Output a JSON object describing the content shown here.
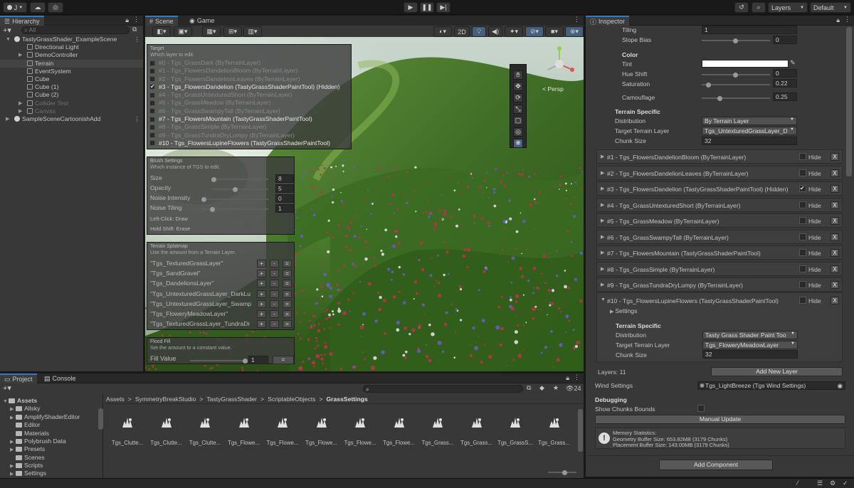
{
  "topbar": {
    "account": "J",
    "layers": "Layers",
    "layout": "Default"
  },
  "hierarchy": {
    "tab": "Hierarchy",
    "search_placeholder": "All",
    "items": [
      {
        "label": "TastyGrassShader_ExampleScene",
        "type": "scene"
      },
      {
        "label": "Directional Light",
        "type": "obj"
      },
      {
        "label": "DemoController",
        "type": "obj"
      },
      {
        "label": "Terrain",
        "type": "obj"
      },
      {
        "label": "EventSystem",
        "type": "obj"
      },
      {
        "label": "Cube",
        "type": "obj"
      },
      {
        "label": "Cube (1)",
        "type": "obj"
      },
      {
        "label": "Cube (2)",
        "type": "obj"
      },
      {
        "label": "Collider Test",
        "type": "obj"
      },
      {
        "label": "Canvas",
        "type": "obj"
      },
      {
        "label": "SampleSceneCartoonishAdd",
        "type": "scene"
      }
    ]
  },
  "scene": {
    "tab_scene": "Scene",
    "tab_game": "Game",
    "btn_2d": "2D",
    "persp": "< Persp"
  },
  "target_overlay": {
    "title": "Target",
    "subtitle": "Which layer to edit.",
    "layers": [
      "#0 - Tgs_GrassDark (ByTerrainLayer)",
      "#1 - Tgs_FlowersDandelionBloom (ByTerrainLayer)",
      "#2 - Tgs_FlowersDandelionLeaves (ByTerrainLayer)",
      "#3 - Tgs_FlowersDandelion (TastyGrassShaderPaintTool) (Hidden)",
      "#4 - Tgs_GrassUntexturedShort (ByTerrainLayer)",
      "#5 - Tgs_GrassMeadow (ByTerrainLayer)",
      "#6 - Tgs_GrassSwampyTall (ByTerrainLayer)",
      "#7 - Tgs_FlowersMountain (TastyGrassShaderPaintTool)",
      "#8 - Tgs_GrassSimple (ByTerrainLayer)",
      "#9 - Tgs_GrassTundraDryLumpy (ByTerrainLayer)",
      "#10 - Tgs_FlowersLupineFlowers (TastyGrassShaderPaintTool)"
    ]
  },
  "brush": {
    "title": "Brush Settings",
    "subtitle": "Which instance of TGS to edit.",
    "size_label": "Size",
    "size": "8",
    "opacity_label": "Opacity",
    "opacity": "5",
    "noise_intensity_label": "Noise Intensity",
    "noise_intensity": "0",
    "noise_tiling_label": "Noise Tiling",
    "noise_tiling": "1",
    "hint1": "Left-Click: Draw",
    "hint2": "Hold Shift: Erase"
  },
  "splatmap": {
    "title": "Terrain Splatmap",
    "subtitle": "Use the amount from a Terrain Layer.",
    "layers": [
      "\"Tgs_TexturedGrassLayer\"",
      "\"Tgs_SandGravel\"",
      "\"Tgs_DandelionsLayer\"",
      "\"Tgs_UntexturedGrassLayer_DarkLu",
      "\"Tgs_UntexturedGrassLayer_Swamp",
      "\"Tgs_FloweryMeadowLayer\"",
      "\"Tgs_TexturedGrassLayer_TundraDr"
    ],
    "plus": "+",
    "minus": "-",
    "eq": "="
  },
  "flood": {
    "title": "Flood Fill",
    "subtitle": "Set the amount to a constant value.",
    "label": "Fill Value",
    "value": "1",
    "eq": "="
  },
  "inspector": {
    "tab": "Inspector",
    "tiling_label": "Tiling",
    "tiling": "1",
    "slope_label": "Slope Bias",
    "slope": "0",
    "color_header": "Color",
    "tint_label": "Tint",
    "hue_label": "Hue Shift",
    "hue": "0",
    "sat_label": "Saturation",
    "sat": "0.22",
    "camo_label": "Camouflage",
    "camo": "0.25",
    "ts_header": "Terrain Specific",
    "dist_label": "Distribution",
    "dist": "By Terrain Layer",
    "ttl_label": "Target Terrain Layer",
    "ttl": "Tgs_UntexturedGrassLayer_D",
    "chunk_label": "Chunk Size",
    "chunk": "32",
    "hide": "Hide",
    "x": "X",
    "layer_rows": [
      {
        "label": "#1 - Tgs_FlowersDandelionBloom (ByTerrainLayer)",
        "hidden": false
      },
      {
        "label": "#2 - Tgs_FlowersDandelionLeaves (ByTerrainLayer)",
        "hidden": false
      },
      {
        "label": "#3 - Tgs_FlowersDandelion (TastyGrassShaderPaintTool) (Hidden)",
        "hidden": true
      },
      {
        "label": "#4 - Tgs_GrassUntexturedShort (ByTerrainLayer)",
        "hidden": false
      },
      {
        "label": "#5 - Tgs_GrassMeadow (ByTerrainLayer)",
        "hidden": false
      },
      {
        "label": "#6 - Tgs_GrassSwampyTall (ByTerrainLayer)",
        "hidden": false
      },
      {
        "label": "#7 - Tgs_FlowersMountain (TastyGrassShaderPaintTool)",
        "hidden": false
      },
      {
        "label": "#8 - Tgs_GrassSimple (ByTerrainLayer)",
        "hidden": false
      },
      {
        "label": "#9 - Tgs_GrassTundraDryLumpy (ByTerrainLayer)",
        "hidden": false
      }
    ],
    "l10": {
      "label": "#10 - Tgs_FlowersLupineFlowers (TastyGrassShaderPaintTool)",
      "settings": "Settings",
      "ts_header": "Terrain Specific",
      "dist_label": "Distribution",
      "dist": "Tasty Grass Shader Paint Too",
      "ttl_label": "Target Terrain Layer",
      "ttl": "Tgs_FloweryMeadowLayer",
      "chunk_label": "Chunk Size",
      "chunk": "32"
    },
    "layers_count": "Layers: 11",
    "add_layer": "Add New Layer",
    "wind_label": "Wind Settings",
    "wind": "Tgs_LightBreeze (Tgs Wind Settings)",
    "debug_header": "Debugging",
    "chunks_label": "Show Chunks Bounds",
    "manual_update": "Manual Update",
    "mem_title": "Memory Statistics:",
    "mem_geo": "Geometry Buffer Size: 653.82MB (3179 Chunks)",
    "mem_place": "Placement Buffer Size: 143.00MB (3179 Chunks)",
    "add_component": "Add Component"
  },
  "project": {
    "tab_project": "Project",
    "tab_console": "Console",
    "count": "24",
    "breadcrumb": [
      "Assets",
      "SymmetryBreakStudio",
      "TastyGrassShader",
      "ScriptableObjects",
      "GrassSettings"
    ],
    "tree_root": "Assets",
    "folders": [
      "Allsky",
      "AmplifyShaderEditor",
      "Editor",
      "Materials",
      "Polybrush Data",
      "Presets",
      "Scenes",
      "Scripts",
      "Settings"
    ],
    "assets": [
      "Tgs_Clutte...",
      "Tgs_Clutte...",
      "Tgs_Clutte...",
      "Tgs_Flowe...",
      "Tgs_Flowe...",
      "Tgs_Flowe...",
      "Tgs_Flowe...",
      "Tgs_Flowe...",
      "Tgs_Grass...",
      "Tgs_Grass...",
      "Tgs_GrassS...",
      "Tgs_Grass..."
    ]
  }
}
